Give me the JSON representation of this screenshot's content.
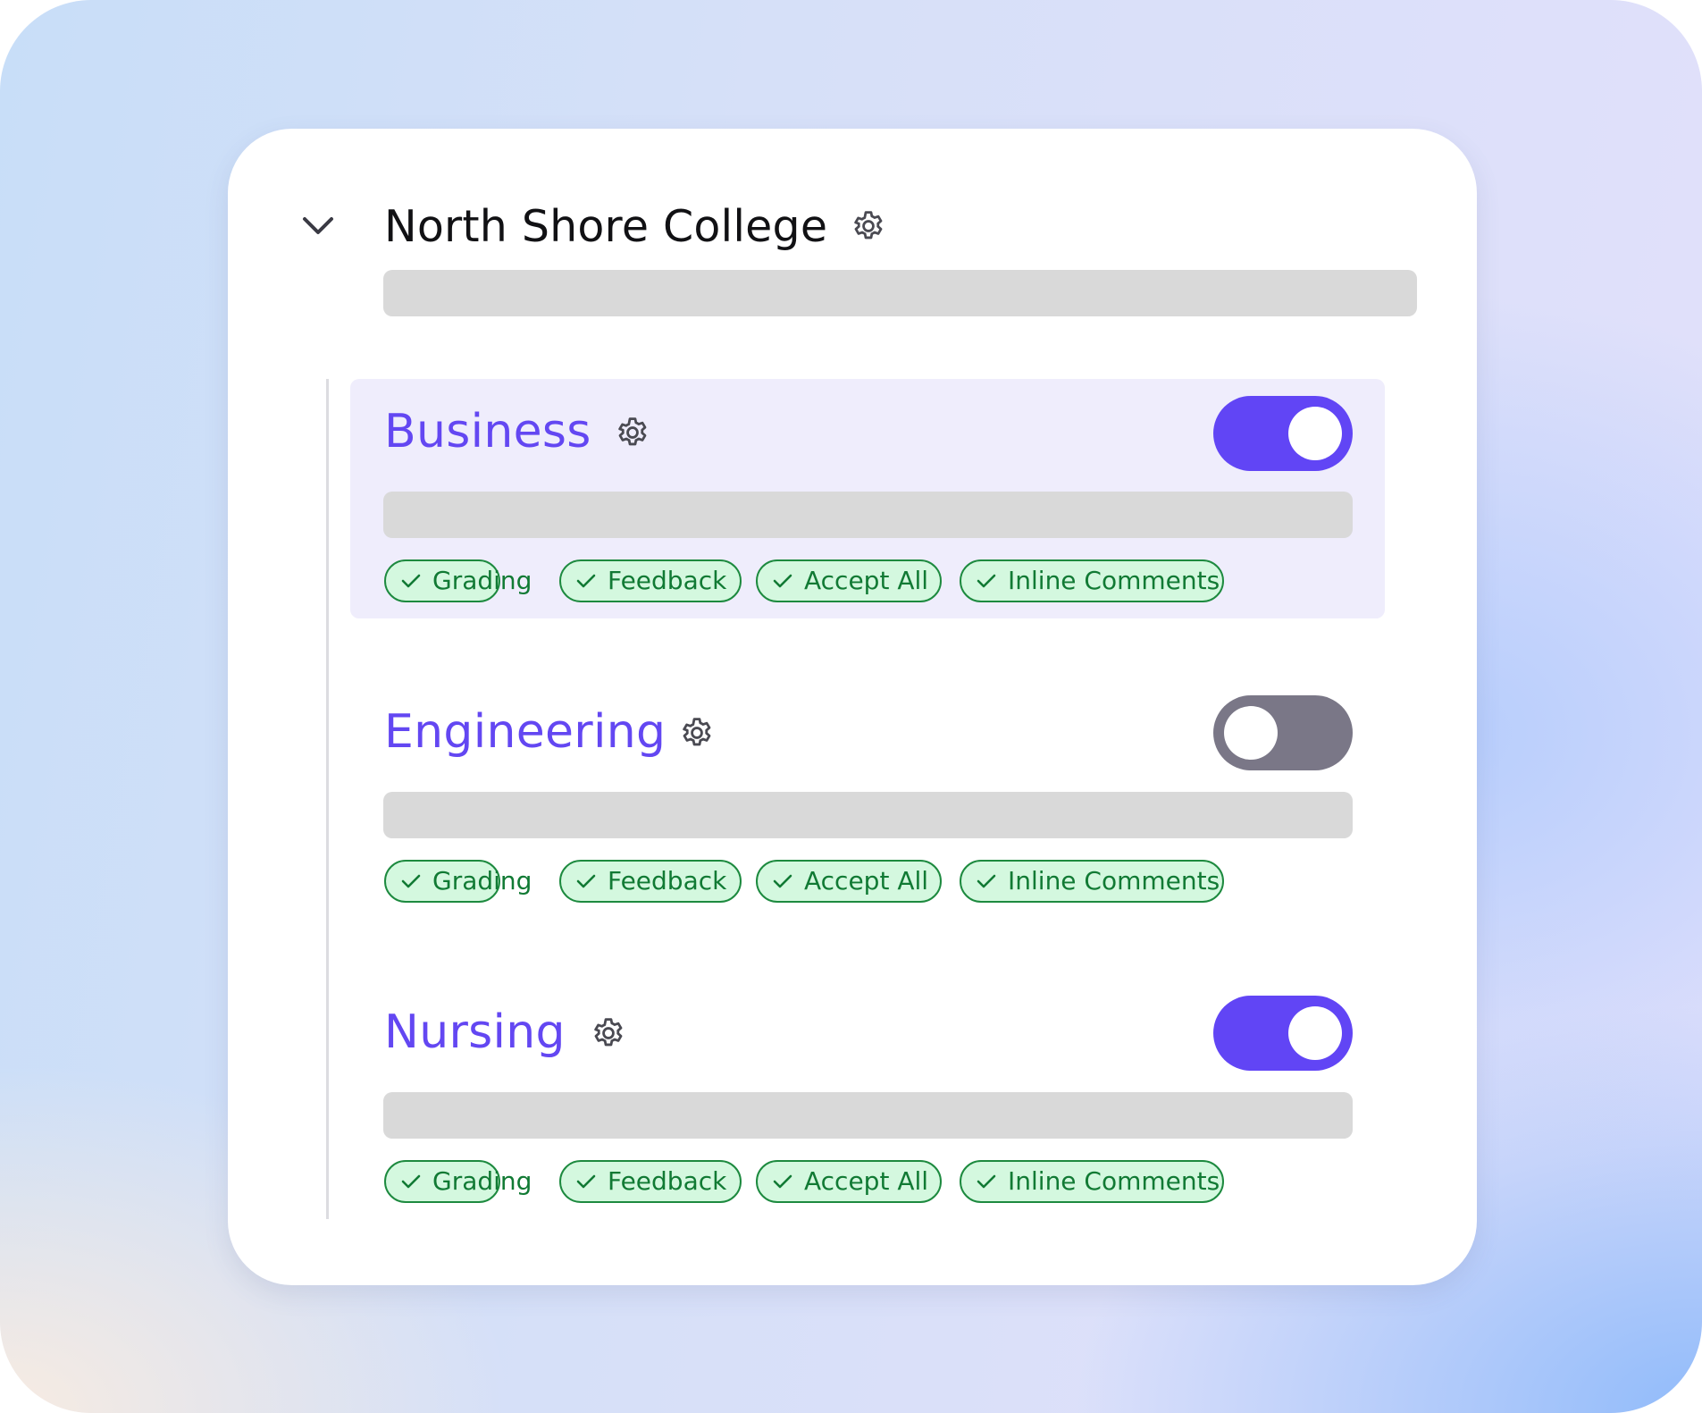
{
  "college": {
    "name": "North Shore College",
    "expand_icon": "chevron-down-icon",
    "settings_icon": "gear-icon"
  },
  "colors": {
    "accent": "#6145f5",
    "department_title": "#6347f2",
    "toggle_off": "#7a7787",
    "tag_border": "#1d8a3f",
    "tag_fill": "#d4f8df",
    "tag_text": "#117a34",
    "placeholder_bar": "#d9d9d9",
    "highlight": "#efedfc"
  },
  "departments": [
    {
      "name": "Business",
      "enabled": true,
      "highlighted": true,
      "tags": [
        "Grading",
        "Feedback",
        "Accept All",
        "Inline Comments"
      ]
    },
    {
      "name": "Engineering",
      "enabled": false,
      "highlighted": false,
      "tags": [
        "Grading",
        "Feedback",
        "Accept All",
        "Inline Comments"
      ]
    },
    {
      "name": "Nursing",
      "enabled": true,
      "highlighted": false,
      "tags": [
        "Grading",
        "Feedback",
        "Accept All",
        "Inline Comments"
      ]
    }
  ]
}
